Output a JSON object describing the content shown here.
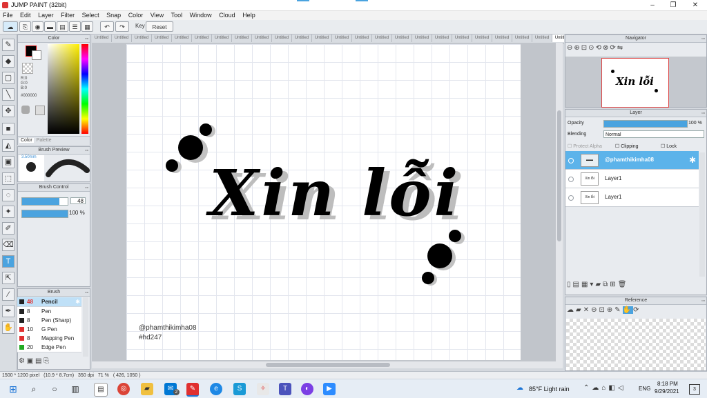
{
  "window": {
    "title": "JUMP PAINT (32bit)",
    "minimize": "–",
    "maximize": "❐",
    "close": "✕"
  },
  "menu": [
    "File",
    "Edit",
    "Layer",
    "Filter",
    "Select",
    "Snap",
    "Color",
    "View",
    "Tool",
    "Window",
    "Cloud",
    "Help"
  ],
  "toolbar": {
    "key_label": "Key",
    "reset_label": "Reset"
  },
  "color_panel": {
    "title": "Color",
    "r": "R:0",
    "g": "G:0",
    "b": "B:0",
    "hex": "#000000",
    "tab_color": "Color",
    "tab_palette": "Palette",
    "fg_color": "#000000",
    "bg_color": "#ffffff"
  },
  "brush_preview": {
    "title": "Brush Preview",
    "size": "3.50mm"
  },
  "brush_control": {
    "title": "Brush Control",
    "size_value": "48",
    "size_level": 0.82,
    "opacity_value": "100 %",
    "opacity_level": 1.0
  },
  "brush_panel": {
    "title": "Brush",
    "items": [
      {
        "size": "48",
        "name": "Pencil",
        "color": "#222222"
      },
      {
        "size": "8",
        "name": "Pen",
        "color": "#222222"
      },
      {
        "size": "8",
        "name": "Pen (Sharp)",
        "color": "#222222"
      },
      {
        "size": "10",
        "name": "G Pen",
        "color": "#e03030"
      },
      {
        "size": "8",
        "name": "Mapping Pen",
        "color": "#e03030"
      },
      {
        "size": "20",
        "name": "Edge Pen",
        "color": "#22aa22"
      }
    ]
  },
  "tabs": [
    "Untitled",
    "Untitled",
    "Untitled",
    "Untitled",
    "Untitled",
    "Untitled",
    "Untitled",
    "Untitled",
    "Untitled",
    "Untitled",
    "Untitled",
    "Untitled",
    "Untitled",
    "Untitled",
    "Untitled",
    "Untitled",
    "Untitled",
    "Untitled",
    "Untitled",
    "Untitled",
    "Untitled",
    "Untitled",
    "Untitled",
    "Untitled"
  ],
  "canvas": {
    "title_text": "Xin lỗi",
    "credit_line1": "@phamthikimha08",
    "credit_line2": "#hd247"
  },
  "navigator": {
    "title": "Navigator",
    "preview_text": "Xin lỗi"
  },
  "layer_panel": {
    "title": "Layer",
    "opacity_label": "Opacity",
    "opacity_value": "100 %",
    "opacity_level": 1.0,
    "blending_label": "Blending",
    "blending_value": "Normal",
    "protect_alpha": "Protect Alpha",
    "clipping": "Clipping",
    "lock": "Lock",
    "layers": [
      {
        "name": "@phamthikimha08",
        "selected": true
      },
      {
        "name": "Layer1",
        "selected": false
      },
      {
        "name": "Layer1",
        "selected": false
      }
    ]
  },
  "reference": {
    "title": "Reference"
  },
  "status": {
    "size": "1500 * 1200 pixel",
    "dimensions": "(10.9 * 8.7cm)",
    "dpi": "350 dpi",
    "zoom": "71 %",
    "coords": "( 426, 1050 )"
  },
  "taskbar": {
    "weather": "85°F  Light rain",
    "lang": "ENG",
    "time": "8:18 PM",
    "date": "9/29/2021",
    "notif_count": "3",
    "mail_badge": "2"
  }
}
